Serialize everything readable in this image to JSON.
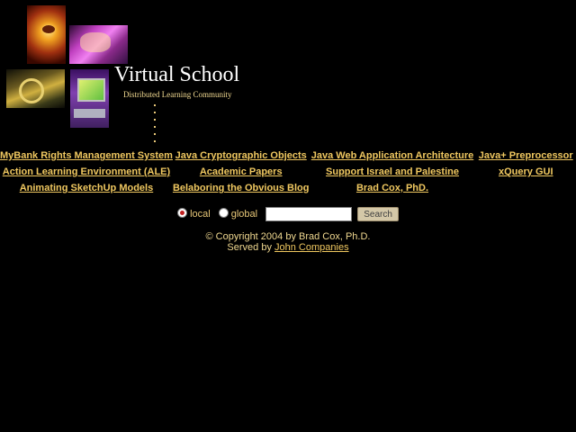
{
  "logo": {
    "title": "Virtual School",
    "subtitle": "Distributed Learning Community"
  },
  "links": [
    [
      "MyBank Rights Management System",
      "Java Cryptographic Objects",
      "Java Web Application Architecture",
      "Java+ Preprocessor"
    ],
    [
      "Action Learning Environment (ALE)",
      "Academic Papers",
      "Support Israel and Palestine",
      "xQuery GUI"
    ],
    [
      "Animating SketchUp Models",
      "Belaboring the Obvious Blog",
      "Brad Cox, PhD.",
      ""
    ]
  ],
  "search": {
    "local_label": "local",
    "global_label": "global",
    "selected": "local",
    "input_value": "",
    "button_label": "Search"
  },
  "footer": {
    "copyright": "© Copyright 2004 by Brad Cox, Ph.D.",
    "served_prefix": "Served by ",
    "served_link": "John Companies"
  },
  "colors": {
    "background": "#000000",
    "link": "#f0c860",
    "title": "#ffffff"
  }
}
